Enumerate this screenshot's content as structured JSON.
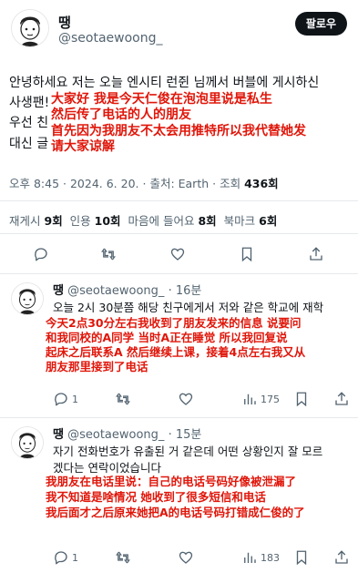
{
  "main_tweet": {
    "display_name": "땡",
    "handle": "@seotaewoong_",
    "follow_label": "팔로우",
    "korean_lines": [
      "안녕하세요 저는 오늘 엔시티 런쥔 님께서 버블에 게시하신",
      "사생팬!",
      "우선 친",
      "대신 글"
    ],
    "overlay_lines": [
      "大家好 我是今天仁俊在泡泡里说是私生",
      "然后传了电话的人的朋友",
      "首先因为我朋友不太会用推特所以我代替她发",
      "请大家谅解"
    ],
    "meta": {
      "time": "오후 8:45",
      "date": "2024. 6. 20.",
      "source": "출처: Earth",
      "views_label": "조회",
      "views": "436회"
    },
    "stats": {
      "retweets_label": "재게시",
      "retweets": "9회",
      "quotes_label": "인용",
      "quotes": "10회",
      "likes_label": "마음에 들어요",
      "likes": "8회",
      "bookmarks_label": "북마크",
      "bookmarks": "6회"
    }
  },
  "replies": [
    {
      "name": "땡",
      "handle": "@seotaewoong_",
      "time": "· 16분",
      "korean_line": "오늘 2시 30분쯤 해당 친구에게서 저와 같은 학교에 재학",
      "overlay_lines": [
        "今天2点30分左右我收到了朋友发来的信息 说要问",
        "和我同校的A同学 当时A正在睡觉 所以我回复说",
        "起床之后联系A 然后继续上课，接着4点左右我又从",
        "朋友那里接到了电话"
      ],
      "views": "175"
    },
    {
      "name": "땡",
      "handle": "@seotaewoong_",
      "time": "· 15분",
      "korean_lines": [
        "자기 전화번호가 유출된 거 같은데 어떤 상황인지 잘 모르",
        "겠다는 연락이었습니다"
      ],
      "overlay_lines": [
        "我朋友在电话里说：自己的电话号码好像被泄漏了",
        "我不知道是啥情况 她收到了很多短信和电话",
        "我后面才之后原来她把A的电话号码打错成仁俊的了"
      ],
      "views": "183"
    }
  ],
  "icons": {
    "reply": "reply-icon",
    "retweet": "retweet-icon",
    "like": "heart-icon",
    "bookmark": "bookmark-icon",
    "share": "share-icon",
    "views": "views-icon"
  }
}
